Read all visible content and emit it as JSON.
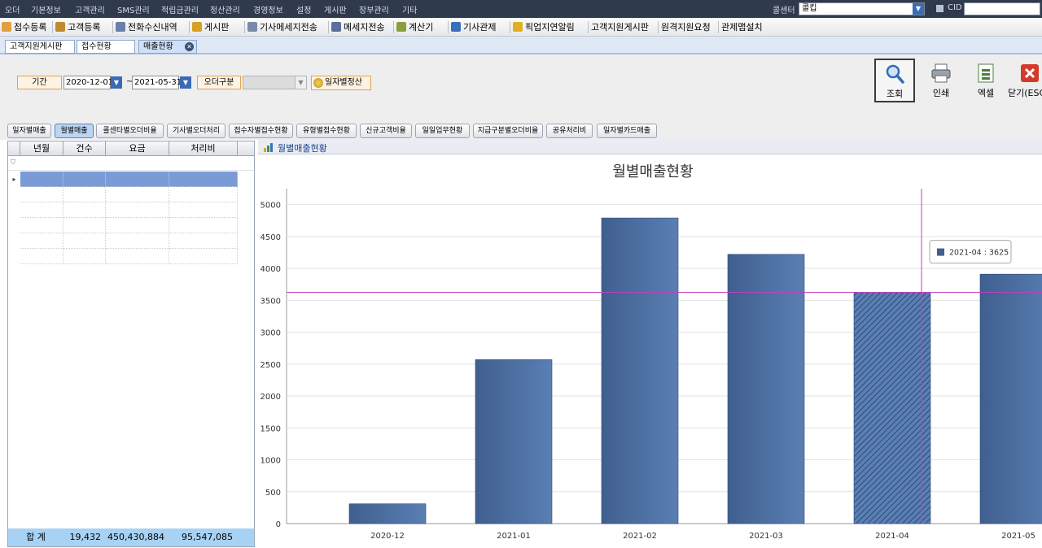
{
  "menu": {
    "items": [
      "오더",
      "기본정보",
      "고객관리",
      "SMS관리",
      "적립금관리",
      "정산관리",
      "경영정보",
      "설정",
      "게시판",
      "장부관리",
      "기타"
    ],
    "callcenter_label": "콜센터",
    "callcenter_value": "콜킵",
    "cid_label": "CID"
  },
  "toolbar": {
    "items": [
      {
        "label": "접수등록",
        "icon": "order-register-icon"
      },
      {
        "label": "고객등록",
        "icon": "customer-register-icon"
      },
      {
        "label": "전화수신내역",
        "icon": "call-log-icon"
      },
      {
        "label": "게시판",
        "icon": "board-icon"
      },
      {
        "label": "기사메세지전송",
        "icon": "driver-message-icon"
      },
      {
        "label": "메세지전송",
        "icon": "message-icon"
      },
      {
        "label": "계산기",
        "icon": "calculator-icon"
      },
      {
        "label": "기사관제",
        "icon": "driver-control-icon"
      },
      {
        "label": "픽업지연알림",
        "icon": "pickup-delay-icon"
      },
      {
        "label": "고객지원게시판",
        "icon": ""
      },
      {
        "label": "원격지원요청",
        "icon": ""
      },
      {
        "label": "관제맵설치",
        "icon": ""
      }
    ]
  },
  "tabs": [
    "고객지원게시판",
    "접수현황",
    "매출현황"
  ],
  "filter": {
    "period_label": "기간",
    "date_from": "2020-12-01",
    "date_to": "2021-05-31",
    "tilde": "~",
    "order_type_label": "오더구분",
    "daily_settle_label": "일자별정산"
  },
  "actions": {
    "search": "조회",
    "print": "인쇄",
    "excel": "엑셀",
    "close": "닫기(ESC)"
  },
  "subtabs": [
    "일자별매출",
    "월별매출",
    "콜센타별오더비율",
    "기사별오더처리",
    "접수자별접수현황",
    "유형별접수현황",
    "신규고객비율",
    "일일업무현황",
    "지급구분별오더비율",
    "공유처리비",
    "일자별카드매출"
  ],
  "grid": {
    "columns": [
      "년월",
      "건수",
      "요금",
      "처리비"
    ],
    "totals": {
      "label": "합 계",
      "count": "19,432",
      "fee": "450,430,884",
      "processing": "95,547,085"
    }
  },
  "chart_panel_title": "월별매출현황",
  "chart_data": {
    "type": "bar",
    "title": "월별매출현황",
    "categories": [
      "2020-12",
      "2021-01",
      "2021-02",
      "2021-03",
      "2021-04",
      "2021-05"
    ],
    "values": [
      310,
      2570,
      4790,
      4220,
      3625,
      3910
    ],
    "ylim": [
      0,
      5250
    ],
    "yticks": [
      "0",
      "500",
      "1000",
      "1500",
      "2000",
      "2500",
      "3000",
      "3500",
      "4000",
      "4500",
      "5000"
    ],
    "grid": true,
    "highlight_index": 4,
    "tooltip": "2021-04 : 3625",
    "colors": {
      "bar": "#3f5f8f",
      "bar_light": "#5a7fb3",
      "crosshair": "#c040c0"
    }
  }
}
